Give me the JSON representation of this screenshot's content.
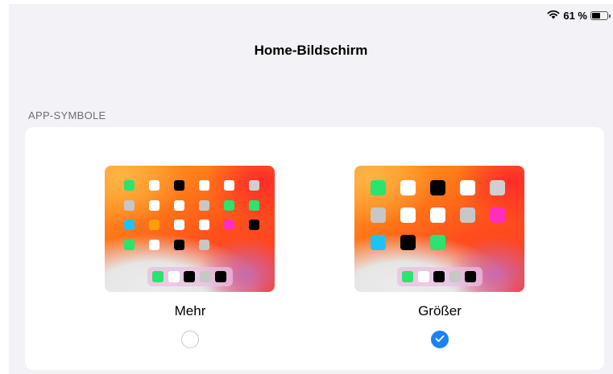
{
  "status_bar": {
    "wifi_icon": "wifi-icon",
    "battery_text": "61 %",
    "battery_level": 0.61
  },
  "nav": {
    "title": "Home-Bildschirm"
  },
  "section": {
    "header": "APP-SYMBOLE"
  },
  "options": [
    {
      "label": "Mehr",
      "selected": false,
      "icons": [
        [
          "#2be36f",
          "#ffffff",
          "#000000",
          "#ffffff",
          "#ffffff",
          "#cfcfcf"
        ],
        [
          "#c7c7c7",
          "#ffffff",
          "#ffffff",
          "#c7c7c7",
          "#2be36f",
          "#2be36f"
        ],
        [
          "#1ec3f5",
          "#ff9f0a",
          "#ffffff",
          "#ffffff",
          "#ff2dbe",
          "#000000"
        ],
        [
          "#2be36f",
          "#ffffff",
          "#000000",
          "#c7c7c7"
        ]
      ],
      "dock": [
        "#2be36f",
        "#ffffff",
        "#000000",
        "#c7c7c7",
        "#000000"
      ]
    },
    {
      "label": "Größer",
      "selected": true,
      "icons": [
        [
          "#2be36f",
          "#ffffff",
          "#000000",
          "#ffffff",
          "#cfcfcf"
        ],
        [
          "#c7c7c7",
          "#ffffff",
          "#ffffff",
          "#c7c7c7",
          "#ff2dbe"
        ],
        [
          "#1ec3f5",
          "#000000",
          "#2be36f"
        ]
      ],
      "dock": [
        "#2be36f",
        "#ffffff",
        "#000000",
        "#c7c7c7",
        "#000000"
      ]
    }
  ],
  "colors": {
    "accent": "#1a82f7",
    "background": "#f2f2f7",
    "section_text": "#6d6d72"
  }
}
